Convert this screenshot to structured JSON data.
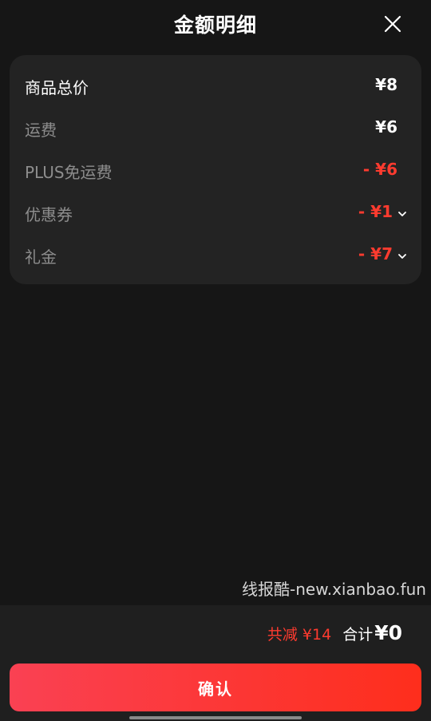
{
  "header": {
    "title": "金额明细",
    "close_icon": "close-icon"
  },
  "breakdown": {
    "items": [
      {
        "label": "商品总价",
        "value": "¥8",
        "highlight": false
      },
      {
        "label": "运费",
        "value": "¥6",
        "highlight": false
      },
      {
        "label": "PLUS免运费",
        "value": "- ¥6",
        "highlight": true
      },
      {
        "label": "优惠券",
        "value": "- ¥1",
        "highlight": true,
        "expandable": true
      },
      {
        "label": "礼金",
        "value": "- ¥7",
        "highlight": true,
        "expandable": true
      }
    ]
  },
  "watermark": "线报酷-new.xianbao.fun",
  "footer": {
    "saved_text": "共减 ¥14",
    "total_label": "合计",
    "total_value": "¥0",
    "confirm_label": "确认"
  },
  "colors": {
    "background": "#161616",
    "card": "#232323",
    "footer": "#1f1f1f",
    "accent_red": "#ff3b2f",
    "button_gradient_start": "#fa4153",
    "button_gradient_end": "#fe2e1c"
  }
}
